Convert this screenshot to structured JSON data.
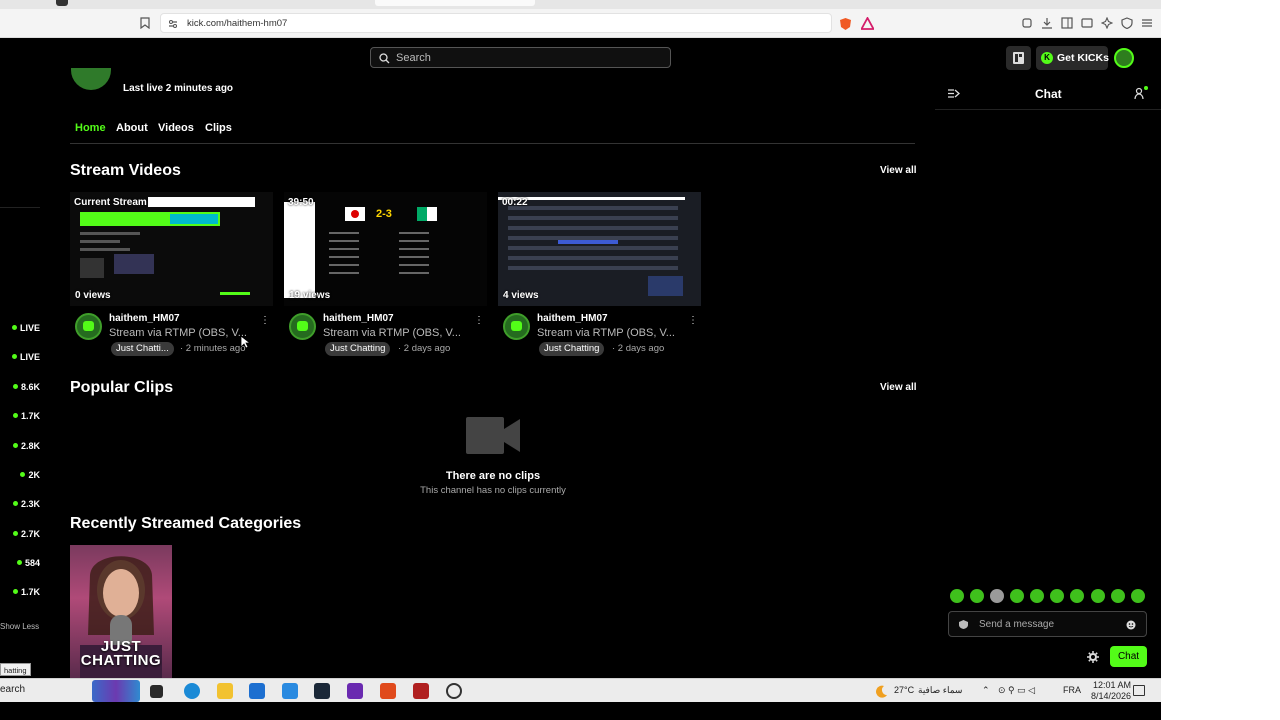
{
  "browser": {
    "url": "kick.com/haithem-hm07"
  },
  "header": {
    "search_placeholder": "Search",
    "get_kicks_label": "Get KICKs",
    "kicks_icon_letter": "K"
  },
  "sidebar": {
    "live_items": [
      {
        "label": "LIVE"
      },
      {
        "label": "LIVE"
      },
      {
        "label": "8.6K"
      },
      {
        "label": "1.7K"
      },
      {
        "label": "2.8K"
      },
      {
        "label": "2K"
      },
      {
        "label": "2.3K"
      },
      {
        "label": "2.7K"
      },
      {
        "label": "584"
      },
      {
        "label": "1.7K"
      }
    ],
    "show_less": "Show Less",
    "tooltip": "hatting"
  },
  "channel": {
    "last_live": "Last live 2 minutes ago",
    "tabs": [
      "Home",
      "About",
      "Videos",
      "Clips"
    ]
  },
  "stream_videos": {
    "title": "Stream Videos",
    "view_all": "View all",
    "cards": [
      {
        "badge": "Current Stream",
        "views": "0 views",
        "channel": "haithem_HM07",
        "title": "Stream via RTMP (OBS, V...",
        "category": "Just Chatti...",
        "time": "· 2 minutes ago"
      },
      {
        "badge": "39:50",
        "views": "19 views",
        "channel": "haithem_HM07",
        "title": "Stream via RTMP (OBS, V...",
        "category": "Just Chatting",
        "time": "· 2 days ago",
        "score": "2-3"
      },
      {
        "badge": "00:22",
        "views": "4 views",
        "channel": "haithem_HM07",
        "title": "Stream via RTMP (OBS, V...",
        "category": "Just Chatting",
        "time": "· 2 days ago"
      }
    ]
  },
  "popular_clips": {
    "title": "Popular Clips",
    "view_all": "View all",
    "empty_title": "There are no clips",
    "empty_subtitle": "This channel has no clips currently"
  },
  "categories": {
    "title": "Recently Streamed Categories",
    "items": [
      {
        "line1": "JUST",
        "line2": "CHATTING"
      }
    ]
  },
  "chat": {
    "title": "Chat",
    "message_placeholder": "Send a message",
    "send_label": "Chat"
  },
  "taskbar": {
    "search_label": "earch",
    "temperature": "27°C",
    "weather": "سماء صافية",
    "language": "FRA",
    "time": "12:01 AM",
    "date": "8/14/2026"
  },
  "colors": {
    "accent": "#53fc18",
    "page_bg": "#000000"
  }
}
